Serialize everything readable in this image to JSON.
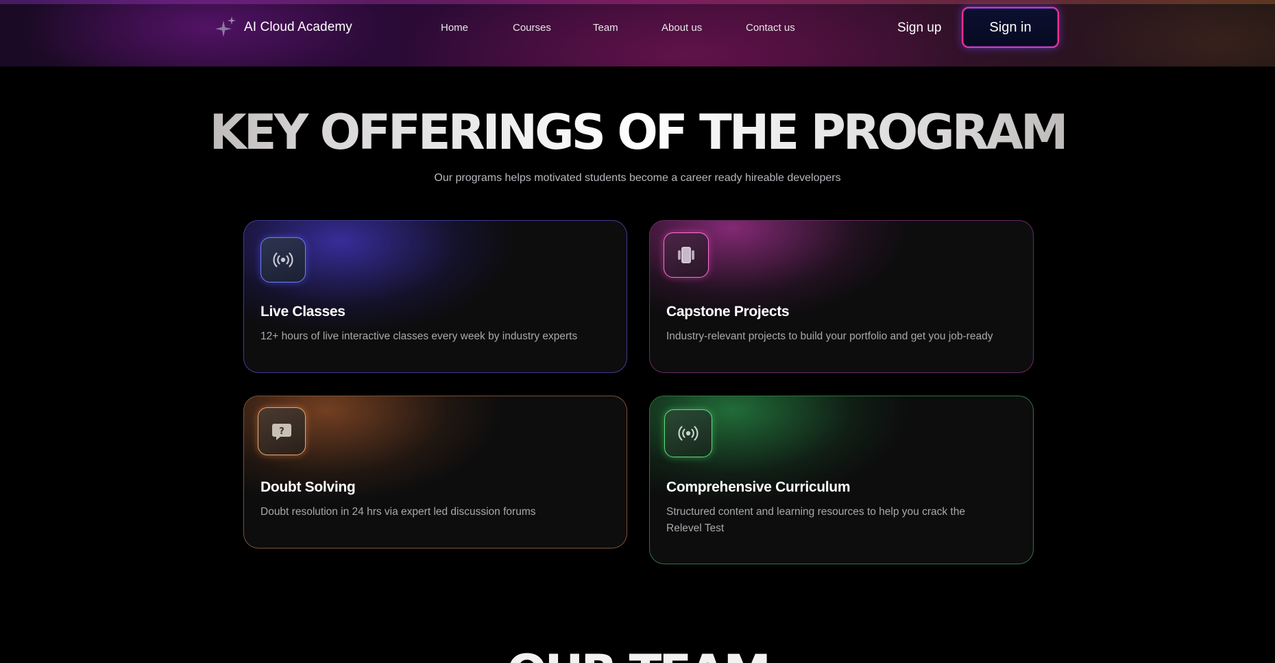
{
  "app": {
    "name": "AI Cloud Academy"
  },
  "nav": {
    "links": [
      "Home",
      "Courses",
      "Team",
      "About us",
      "Contact us"
    ],
    "signup_label": "Sign up",
    "signin_label": "Sign in"
  },
  "hero": {
    "title": "KEY OFFERINGS OF THE PROGRAM",
    "subtitle": "Our programs helps motivated students become a career ready hireable developers"
  },
  "offerings": [
    {
      "icon": "broadcast-icon",
      "accent": "#6f7cff",
      "title": "Live Classes",
      "description": "12+ hours of live interactive classes every week by industry experts"
    },
    {
      "icon": "capstone-icon",
      "accent": "#ff6fd9",
      "title": "Capstone Projects",
      "description": "Industry-relevant projects to build your portfolio and get you job-ready"
    },
    {
      "icon": "question-chat-icon",
      "accent": "#f0a565",
      "title": "Doubt Solving",
      "description": "Doubt resolution in 24 hrs via expert led discussion forums"
    },
    {
      "icon": "broadcast-icon",
      "accent": "#5ce07a",
      "title": "Comprehensive Curriculum",
      "description": "Structured content and learning resources to help you crack the Relevel Test"
    }
  ],
  "next_section": {
    "title": "OUR TEAM"
  }
}
